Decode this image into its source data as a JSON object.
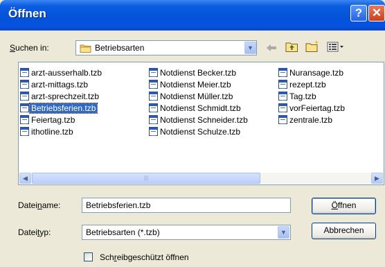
{
  "window": {
    "title": "Öffnen",
    "help_glyph": "?",
    "close_glyph": "✕"
  },
  "lookin": {
    "label_prefix": "S",
    "label_rest": "uchen in:",
    "value": "Betriebsarten"
  },
  "files": [
    "arzt-ausserhalb.tzb",
    "arzt-mittags.tzb",
    "arzt-sprechzeit.tzb",
    "Betriebsferien.tzb",
    "Feiertag.tzb",
    "ithotline.tzb",
    "Notdienst Becker.tzb",
    "Notdienst Meier.tzb",
    "Notdienst Müller.tzb",
    "Notdienst Schmidt.tzb",
    "Notdienst Schneider.tzb",
    "Notdienst Schulze.tzb",
    "Nuransage.tzb",
    "rezept.tzb",
    "Tag.tzb",
    "vorFeiertag.tzb",
    "zentrale.tzb"
  ],
  "selected_file": "Betriebsferien.tzb",
  "filename": {
    "label_a": "Datei",
    "label_u": "n",
    "label_b": "ame:",
    "value": "Betriebsferien.tzb"
  },
  "filetype": {
    "label_a": "Datei",
    "label_u": "t",
    "label_b": "yp:",
    "value": "Betriebsarten (*.tzb)"
  },
  "buttons": {
    "open_u": "Ö",
    "open_rest": "ffnen",
    "cancel": "Abbrechen"
  },
  "readonly": {
    "label_a": "Sch",
    "label_u": "r",
    "label_b": "eibgeschützt öffnen",
    "checked": false
  },
  "colors": {
    "titlebar": "#0453d8",
    "selection": "#316ac5",
    "dialog_bg": "#ece9d8"
  }
}
